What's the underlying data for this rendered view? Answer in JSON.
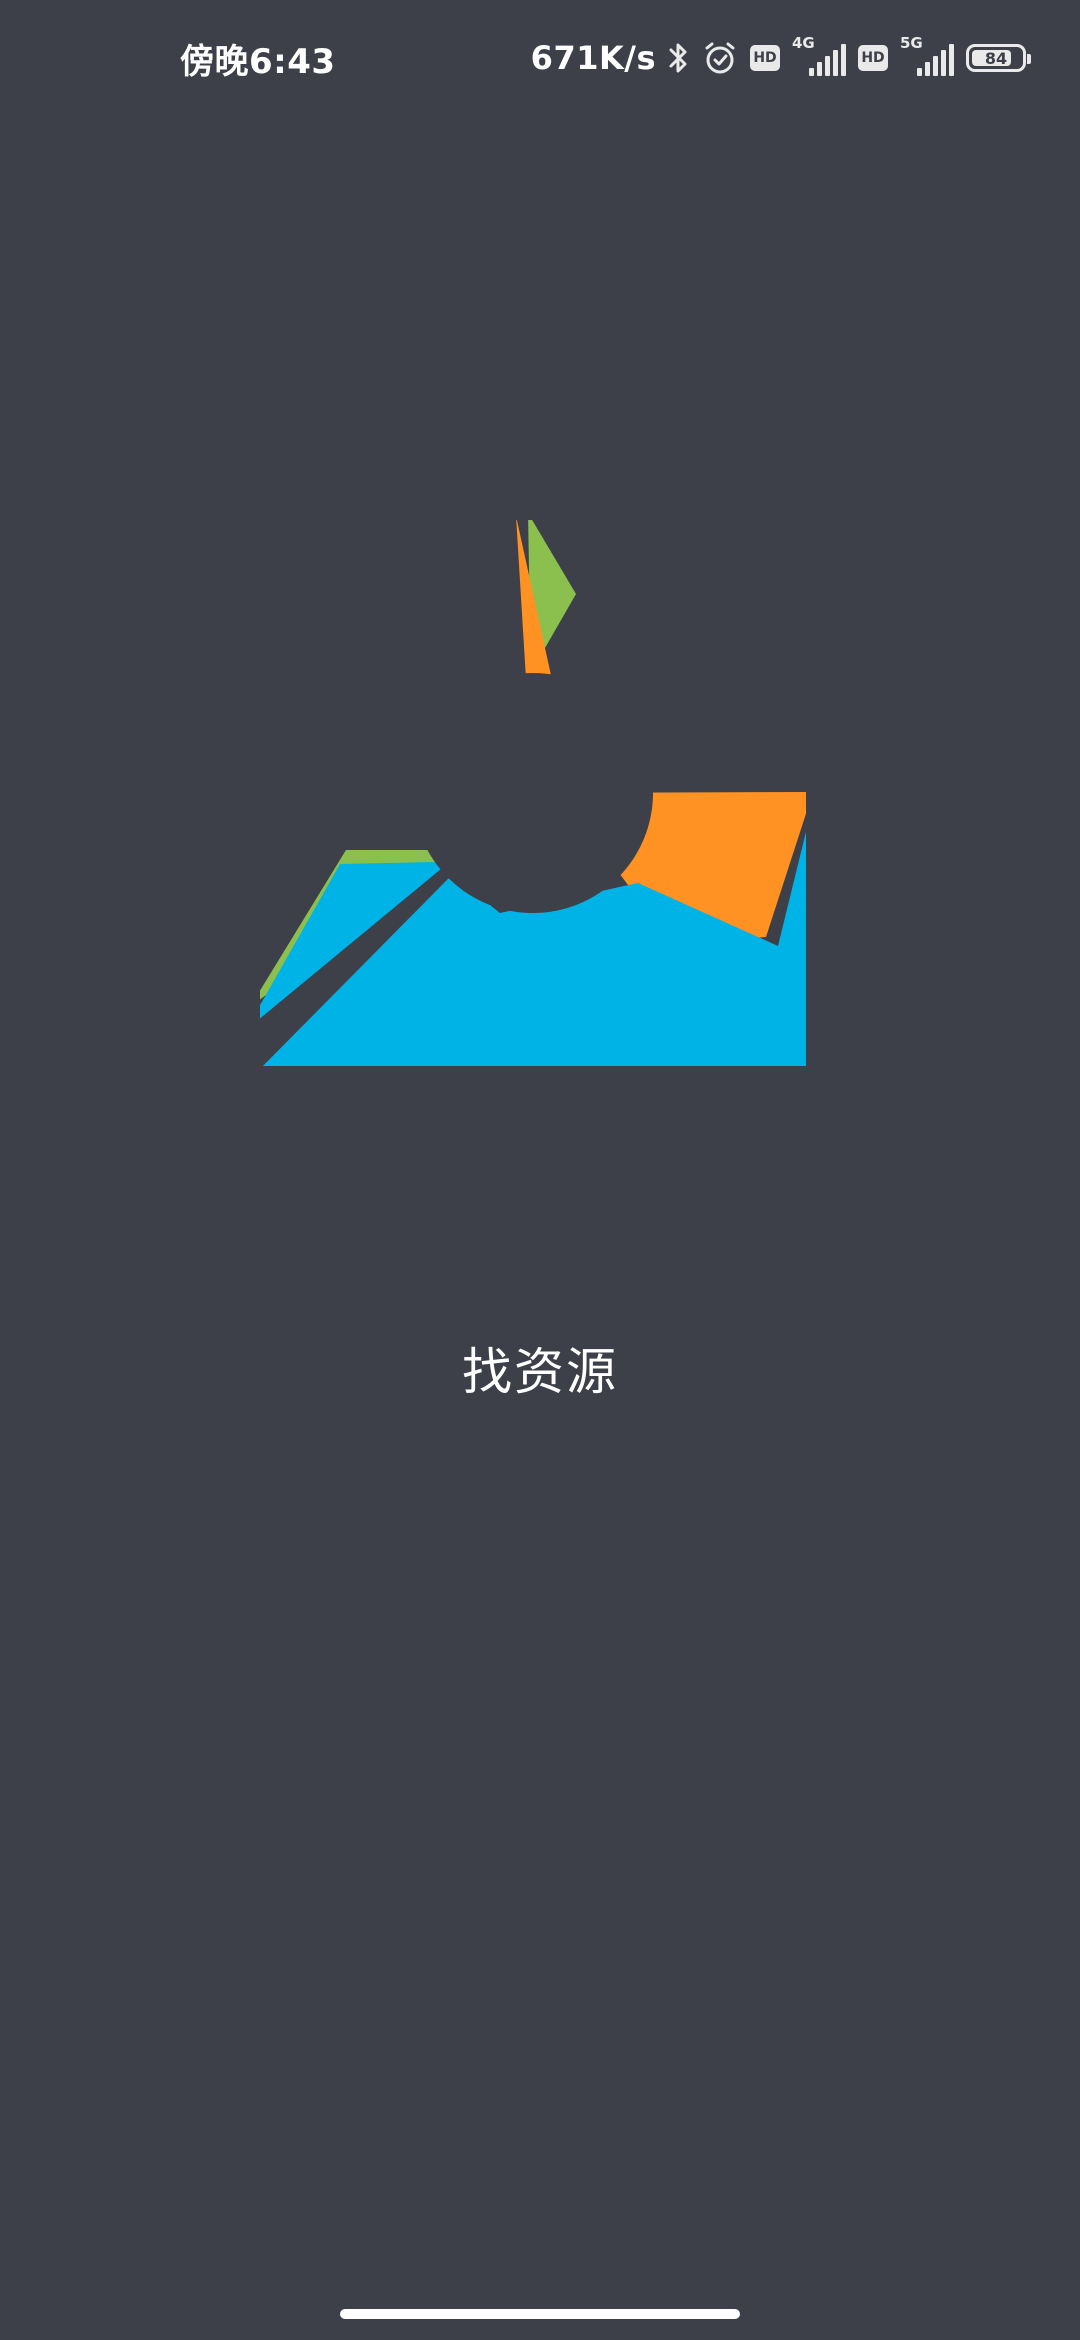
{
  "status_bar": {
    "time": "傍晚6:43",
    "net_speed": "671K/s",
    "hd_label": "HD",
    "network_1": "4G",
    "network_2": "5G",
    "battery_level": 84,
    "battery_text": "84",
    "icons": [
      "bluetooth-icon",
      "alarm-icon",
      "hd-icon",
      "signal-4g-icon",
      "hd-icon",
      "signal-5g-icon",
      "battery-icon"
    ]
  },
  "splash": {
    "app_name": "找资源",
    "logo_icon": "cycle-ring-logo",
    "colors": {
      "background": "#3d4048",
      "green": "#8bc04f",
      "orange": "#ff9222",
      "blue": "#00b3e6"
    }
  }
}
